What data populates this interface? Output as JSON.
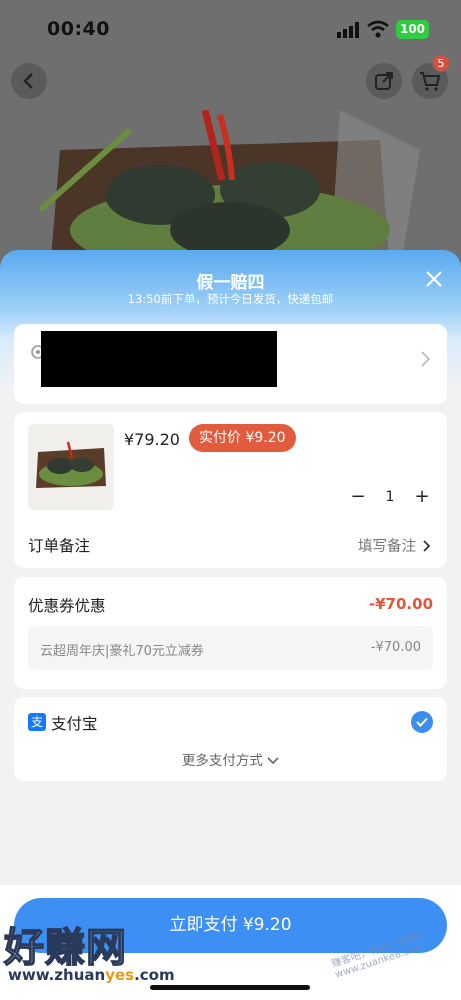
{
  "status_bar": {
    "time": "00:40",
    "battery": "100"
  },
  "product_page": {
    "cart_count": "5"
  },
  "sheet": {
    "title": "假一赔四",
    "subtitle": "13:50前下单，预计今日发货，快递包邮"
  },
  "order": {
    "price": "¥79.20",
    "pay_price_label": "实付价 ¥9.20",
    "quantity": "1",
    "remark_label": "订单备注",
    "remark_action": "填写备注"
  },
  "coupon": {
    "label": "优惠券优惠",
    "amount": "-¥70.00",
    "name": "云超周年庆|豪礼70元立减券",
    "name_amount": "-¥70.00"
  },
  "payment": {
    "method": "支付宝",
    "more": "更多支付方式"
  },
  "pay_button": {
    "label": "立即支付 ¥9.20"
  },
  "watermark": {
    "brand": "好赚网",
    "url_a": "www.zhuan",
    "url_b": "yes",
    "url_c": ".com",
    "corner": "赚客吧，有钱一起赚！ www.zuanke8.com"
  },
  "colors": {
    "accent": "#3d8ff3",
    "discount": "#e2573a",
    "alipay": "#1677ff"
  }
}
